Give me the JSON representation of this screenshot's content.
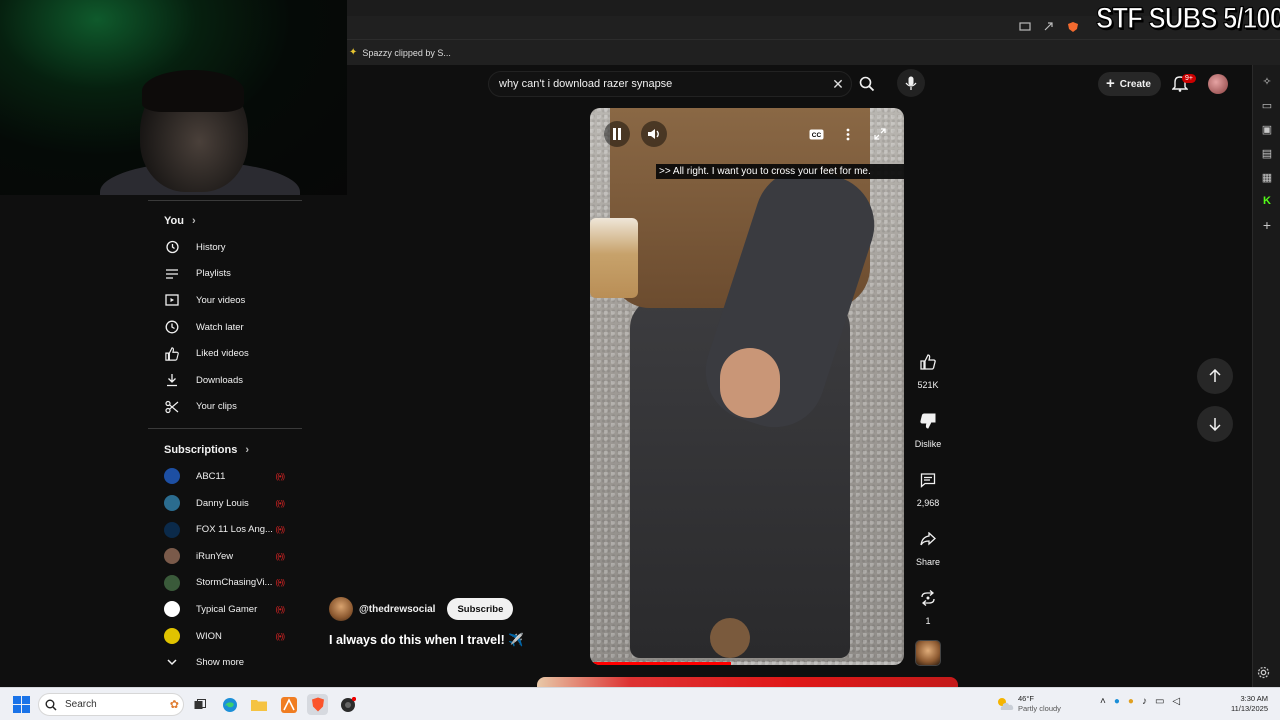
{
  "overlay": {
    "sub_goal": "STF SUBS 5/100"
  },
  "browser": {
    "bookmark_label": "Spazzy clipped by S..."
  },
  "header": {
    "search_query": "why can't i download razer synapse",
    "create_label": "Create",
    "notification_count": "9+"
  },
  "sidebar": {
    "you_label": "You",
    "you_items": [
      {
        "label": "History",
        "icon": "history-icon"
      },
      {
        "label": "Playlists",
        "icon": "playlists-icon"
      },
      {
        "label": "Your videos",
        "icon": "your-videos-icon"
      },
      {
        "label": "Watch later",
        "icon": "watch-later-icon"
      },
      {
        "label": "Liked videos",
        "icon": "liked-videos-icon"
      },
      {
        "label": "Downloads",
        "icon": "downloads-icon"
      },
      {
        "label": "Your clips",
        "icon": "scissors-icon"
      }
    ],
    "subscriptions_label": "Subscriptions",
    "subscriptions": [
      {
        "label": "ABC11",
        "color": "#1d4fa3"
      },
      {
        "label": "Danny Louis",
        "color": "#2b6c8f"
      },
      {
        "label": "FOX 11 Los Ang...",
        "color": "#0b2a4a"
      },
      {
        "label": "iRunYew",
        "color": "#7a5a4a"
      },
      {
        "label": "StormChasingVi...",
        "color": "#3a5a3a"
      },
      {
        "label": "Typical Gamer",
        "color": "#ffffff"
      },
      {
        "label": "WION",
        "color": "#e0c300"
      }
    ],
    "show_more_label": "Show more"
  },
  "video": {
    "caption": ">> All right. I want you to cross your feet for me.",
    "progress": 0.45
  },
  "short": {
    "channel_handle": "@thedrewsocial",
    "subscribe_label": "Subscribe",
    "title": "I always do this when I travel! ✈️"
  },
  "actions": {
    "like_count": "521K",
    "dislike_label": "Dislike",
    "comment_count": "2,968",
    "share_label": "Share",
    "remix_count": "1"
  },
  "taskbar": {
    "search_placeholder": "Search",
    "temperature": "46°F",
    "weather": "Partly cloudy",
    "time": "3:30 AM",
    "date": "11/13/2025"
  },
  "colors": {
    "accent_red": "#ff0000",
    "background": "#0f0f0f"
  }
}
